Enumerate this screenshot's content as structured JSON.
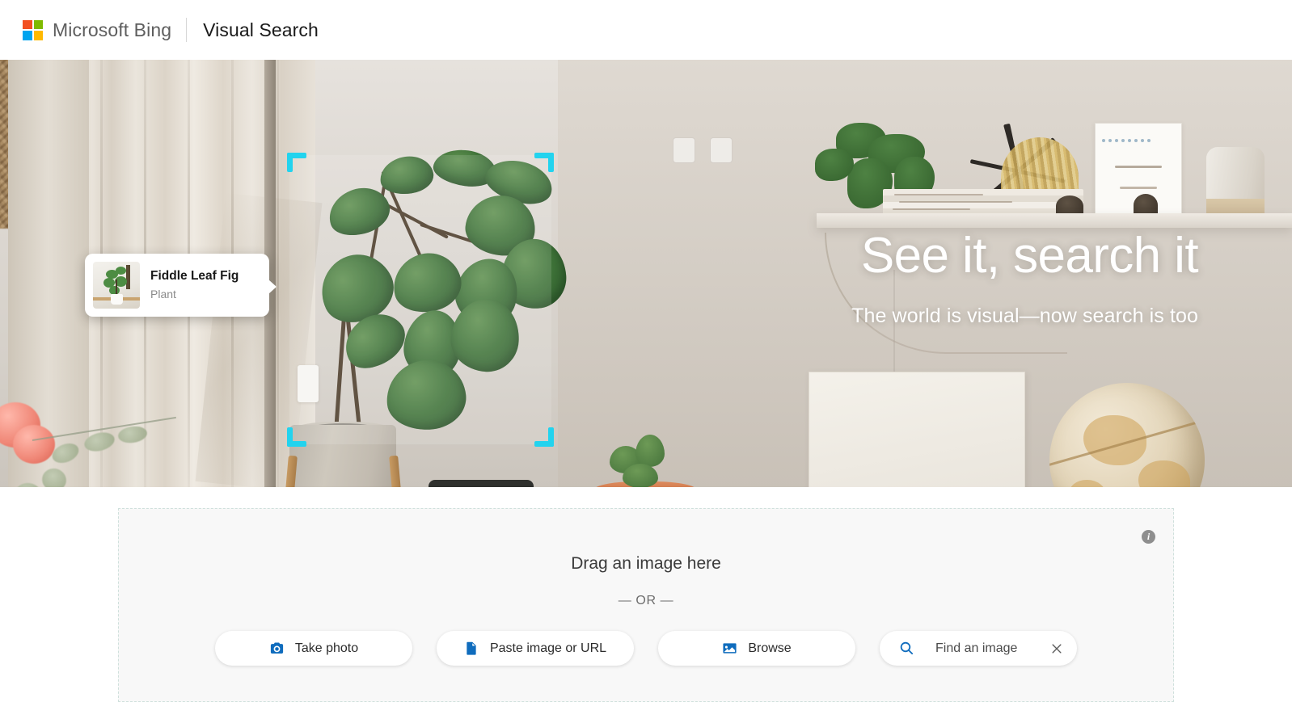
{
  "header": {
    "logo_name": "microsoft-logo",
    "brand": "Microsoft Bing",
    "product": "Visual Search"
  },
  "hero": {
    "title": "See it, search it",
    "subtitle": "The world is visual—now search is too",
    "selection_box": {
      "label": "object-selection-box",
      "corner_color": "#22d3ee"
    },
    "detected_object": {
      "title": "Fiddle Leaf Fig",
      "category": "Plant"
    }
  },
  "dropzone": {
    "title": "Drag an image here",
    "or_divider": "— OR —",
    "info_glyph": "i",
    "buttons": [
      {
        "label": "Take photo",
        "icon": "camera-icon"
      },
      {
        "label": "Paste image or URL",
        "icon": "document-icon"
      },
      {
        "label": "Browse",
        "icon": "image-icon"
      }
    ],
    "find": {
      "icon": "search-icon",
      "placeholder": "Find an image",
      "value": "",
      "clear_icon": "close-icon"
    }
  },
  "colors": {
    "accent_blue": "#0f6cbd",
    "selection_cyan": "#22d3ee",
    "ms_red": "#f25022",
    "ms_green": "#7fba00",
    "ms_blue": "#00a4ef",
    "ms_yellow": "#ffb900"
  }
}
